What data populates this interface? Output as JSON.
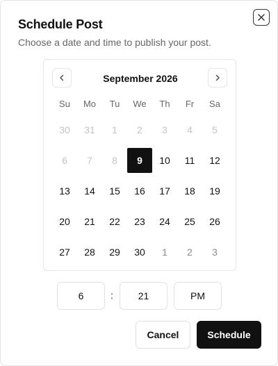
{
  "dialog": {
    "title": "Schedule Post",
    "subtitle": "Choose a date and time to publish your post.",
    "close_icon": "x-icon"
  },
  "calendar": {
    "month_label": "September 2026",
    "prev_icon": "chevron-left-icon",
    "next_icon": "chevron-right-icon",
    "weekdays": [
      "Su",
      "Mo",
      "Tu",
      "We",
      "Th",
      "Fr",
      "Sa"
    ],
    "days": [
      {
        "label": "30",
        "state": "muted"
      },
      {
        "label": "31",
        "state": "muted"
      },
      {
        "label": "1",
        "state": "muted"
      },
      {
        "label": "2",
        "state": "muted"
      },
      {
        "label": "3",
        "state": "muted"
      },
      {
        "label": "4",
        "state": "muted"
      },
      {
        "label": "5",
        "state": "muted"
      },
      {
        "label": "6",
        "state": "muted"
      },
      {
        "label": "7",
        "state": "muted"
      },
      {
        "label": "8",
        "state": "muted"
      },
      {
        "label": "9",
        "state": "selected"
      },
      {
        "label": "10",
        "state": "normal"
      },
      {
        "label": "11",
        "state": "normal"
      },
      {
        "label": "12",
        "state": "normal"
      },
      {
        "label": "13",
        "state": "normal"
      },
      {
        "label": "14",
        "state": "normal"
      },
      {
        "label": "15",
        "state": "normal"
      },
      {
        "label": "16",
        "state": "normal"
      },
      {
        "label": "17",
        "state": "normal"
      },
      {
        "label": "18",
        "state": "normal"
      },
      {
        "label": "19",
        "state": "normal"
      },
      {
        "label": "20",
        "state": "normal"
      },
      {
        "label": "21",
        "state": "normal"
      },
      {
        "label": "22",
        "state": "normal"
      },
      {
        "label": "23",
        "state": "normal"
      },
      {
        "label": "24",
        "state": "normal"
      },
      {
        "label": "25",
        "state": "normal"
      },
      {
        "label": "26",
        "state": "normal"
      },
      {
        "label": "27",
        "state": "normal"
      },
      {
        "label": "28",
        "state": "normal"
      },
      {
        "label": "29",
        "state": "normal"
      },
      {
        "label": "30",
        "state": "normal"
      },
      {
        "label": "1",
        "state": "outside"
      },
      {
        "label": "2",
        "state": "outside"
      },
      {
        "label": "3",
        "state": "outside"
      }
    ]
  },
  "time": {
    "hour": "6",
    "separator": ":",
    "minute": "21",
    "period": "PM"
  },
  "actions": {
    "cancel_label": "Cancel",
    "schedule_label": "Schedule"
  },
  "colors": {
    "primary": "#111111",
    "muted_text": "#666666",
    "disabled_day": "#c4c4c4",
    "border": "#e2e2e2"
  }
}
